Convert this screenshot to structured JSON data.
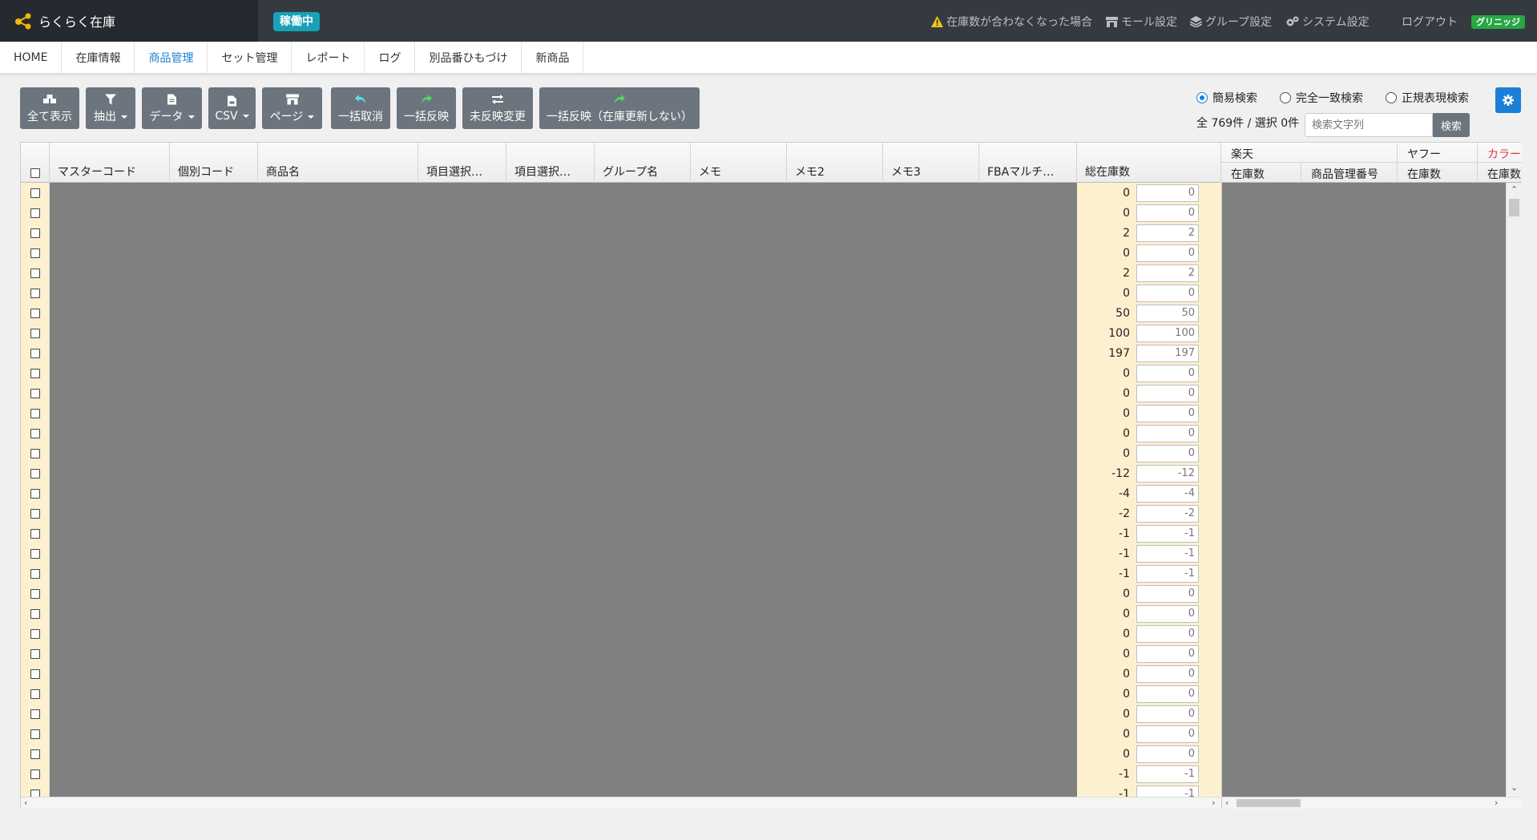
{
  "brand": {
    "name": "らくらく在庫",
    "status": "稼働中"
  },
  "topnav": {
    "warning": "在庫数が合わなくなった場合",
    "mall": "モール設定",
    "group": "グループ設定",
    "system": "システム設定",
    "logout": "ログアウト",
    "user": "グリニッジ"
  },
  "tabs": [
    "HOME",
    "在庫情報",
    "商品管理",
    "セット管理",
    "レポート",
    "ログ",
    "別品番ひもづけ",
    "新商品"
  ],
  "active_tab": "商品管理",
  "toolbar": {
    "show_all": "全て表示",
    "extract": "抽出",
    "data": "データ",
    "csv": "CSV",
    "page": "ページ",
    "bulk_cancel": "一括取消",
    "bulk_apply": "一括反映",
    "unapplied_change": "未反映変更",
    "bulk_apply_no_update": "一括反映（在庫更新しない）"
  },
  "search": {
    "mode_simple": "簡易検索",
    "mode_exact": "完全一致検索",
    "mode_regex": "正規表現検索",
    "selected_mode": "簡易検索",
    "count_text": "全 769件 / 選択 0件",
    "placeholder": "検索文字列",
    "button": "検索"
  },
  "table": {
    "headers": {
      "master_code": "マスターコード",
      "individual_code": "個別コード",
      "product_name": "商品名",
      "item_select_1": "項目選択…",
      "item_select_2": "項目選択…",
      "group_name": "グループ名",
      "memo": "メモ",
      "memo2": "メモ2",
      "memo3": "メモ3",
      "fba_multi": "FBAマルチ…",
      "total_stock": "総在庫数"
    },
    "right_groups": {
      "rakuten": "楽天",
      "yahoo": "ヤフー",
      "color": "カラー",
      "stock": "在庫数",
      "product_mgmt_no": "商品管理番号"
    },
    "color_accent": "#dc3545",
    "total_stock_values": [
      "0",
      "0",
      "2",
      "0",
      "2",
      "0",
      "50",
      "100",
      "197",
      "0",
      "0",
      "0",
      "0",
      "0",
      "-12",
      "-4",
      "-2",
      "-1",
      "-1",
      "-1",
      "0",
      "0",
      "0",
      "0",
      "0",
      "0",
      "0",
      "0",
      "0",
      "-1",
      "-1"
    ],
    "input_values": [
      "0",
      "0",
      "2",
      "0",
      "2",
      "0",
      "50",
      "100",
      "197",
      "0",
      "0",
      "0",
      "0",
      "0",
      "-12",
      "-4",
      "-2",
      "-1",
      "-1",
      "-1",
      "0",
      "0",
      "0",
      "0",
      "0",
      "0",
      "0",
      "0",
      "0",
      "-1",
      "-1"
    ]
  }
}
